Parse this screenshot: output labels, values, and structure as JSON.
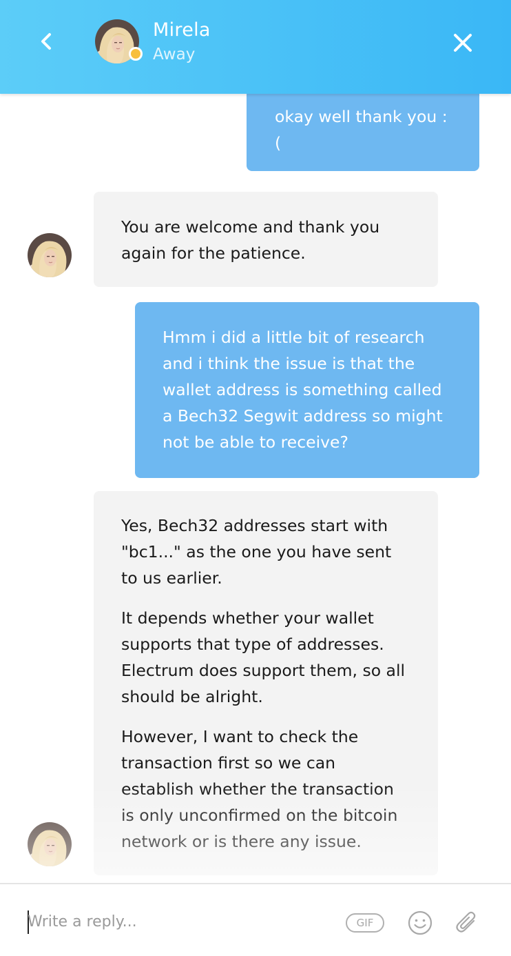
{
  "header": {
    "agent_name": "Mirela",
    "agent_status": "Away",
    "status_color": "#f7bf3e",
    "back_icon": "chevron-left-icon",
    "close_icon": "close-icon"
  },
  "messages": [
    {
      "sender": "user",
      "paragraphs": [
        "okay well thank you : ("
      ]
    },
    {
      "sender": "agent",
      "paragraphs": [
        "You are welcome and thank you again for the patience."
      ]
    },
    {
      "sender": "user",
      "paragraphs": [
        "Hmm i did a little bit of research and i think the issue is that the wallet address is something called a Bech32 Segwit address so might not be able to receive?"
      ]
    },
    {
      "sender": "agent",
      "paragraphs": [
        "Yes, Bech32 addresses start with \"bc1...\" as the one you have sent to us earlier.",
        "It depends whether your wallet supports that type of addresses. Electrum does support them, so all should be alright.",
        "However, I want to check the transaction first so we can establish whether the transaction is only unconfirmed on the bitcoin network or is there any issue."
      ]
    }
  ],
  "composer": {
    "placeholder": "Write a reply...",
    "value": "",
    "gif_label": "GIF",
    "emoji_icon": "smiley-icon",
    "attach_icon": "paperclip-icon"
  },
  "colors": {
    "header_gradient_start": "#5ccdf8",
    "header_gradient_end": "#3ab7f6",
    "user_bubble": "#6eb8f1",
    "agent_bubble": "#f3f3f3"
  }
}
